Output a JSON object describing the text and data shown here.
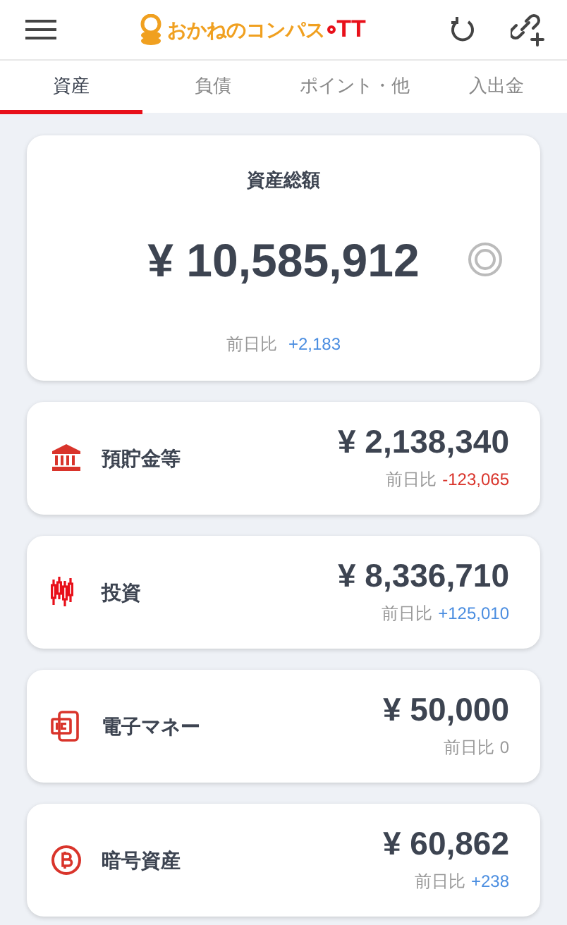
{
  "header": {
    "logo_text": "おかねのコンパス",
    "logo_suffix": "TT"
  },
  "tabs": [
    {
      "label": "資産",
      "selected": true
    },
    {
      "label": "負債",
      "selected": false
    },
    {
      "label": "ポイント・他",
      "selected": false
    },
    {
      "label": "入出金",
      "selected": false
    }
  ],
  "total": {
    "title": "資産総額",
    "amount": "¥ 10,585,912",
    "change_label": "前日比",
    "change": "+2,183",
    "color": "#4a8de0"
  },
  "categories": [
    {
      "kind": "bank",
      "name": "預貯金等",
      "amount": "¥ 2,138,340",
      "change_label": "前日比",
      "change": "-123,065",
      "color": "#d9342b"
    },
    {
      "kind": "invest",
      "name": "投資",
      "amount": "¥ 8,336,710",
      "change_label": "前日比",
      "change": "+125,010",
      "color": "#4a8de0"
    },
    {
      "kind": "emoney",
      "name": "電子マネー",
      "amount": "¥ 50,000",
      "change_label": "前日比",
      "change": "0",
      "color": "#999999"
    },
    {
      "kind": "crypto",
      "name": "暗号資産",
      "amount": "¥ 60,862",
      "change_label": "前日比",
      "change": "+238",
      "color": "#4a8de0"
    }
  ]
}
